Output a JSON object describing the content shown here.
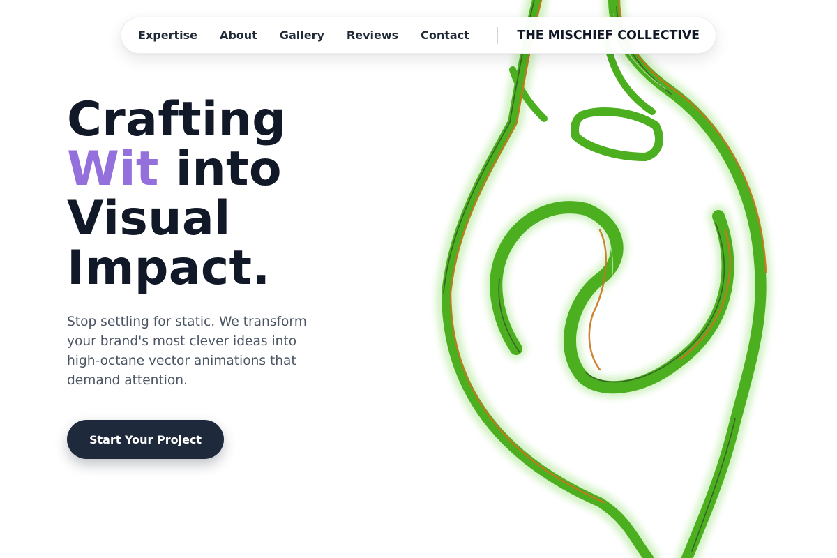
{
  "nav": {
    "links": [
      {
        "label": "Expertise"
      },
      {
        "label": "About"
      },
      {
        "label": "Gallery"
      },
      {
        "label": "Reviews"
      },
      {
        "label": "Contact"
      }
    ],
    "brand": "THE MISCHIEF COLLECTIVE"
  },
  "hero": {
    "headline_line1": "Crafting",
    "headline_accent": "Wit",
    "headline_line2_rest": " into",
    "headline_line3": "Visual",
    "headline_line4": "Impact.",
    "subheading": "Stop settling for static. We transform your brand's most clever ideas into high-octane vector animations that demand attention.",
    "cta_label": "Start Your Project"
  },
  "colors": {
    "accent": "#9370db",
    "heading": "#111827",
    "body_text": "#4b5563",
    "cta_background": "#1e293b",
    "art_green": "#4caf1f",
    "art_orange": "#c9761e"
  },
  "art": {
    "icon": "green-swirl-illustration"
  }
}
